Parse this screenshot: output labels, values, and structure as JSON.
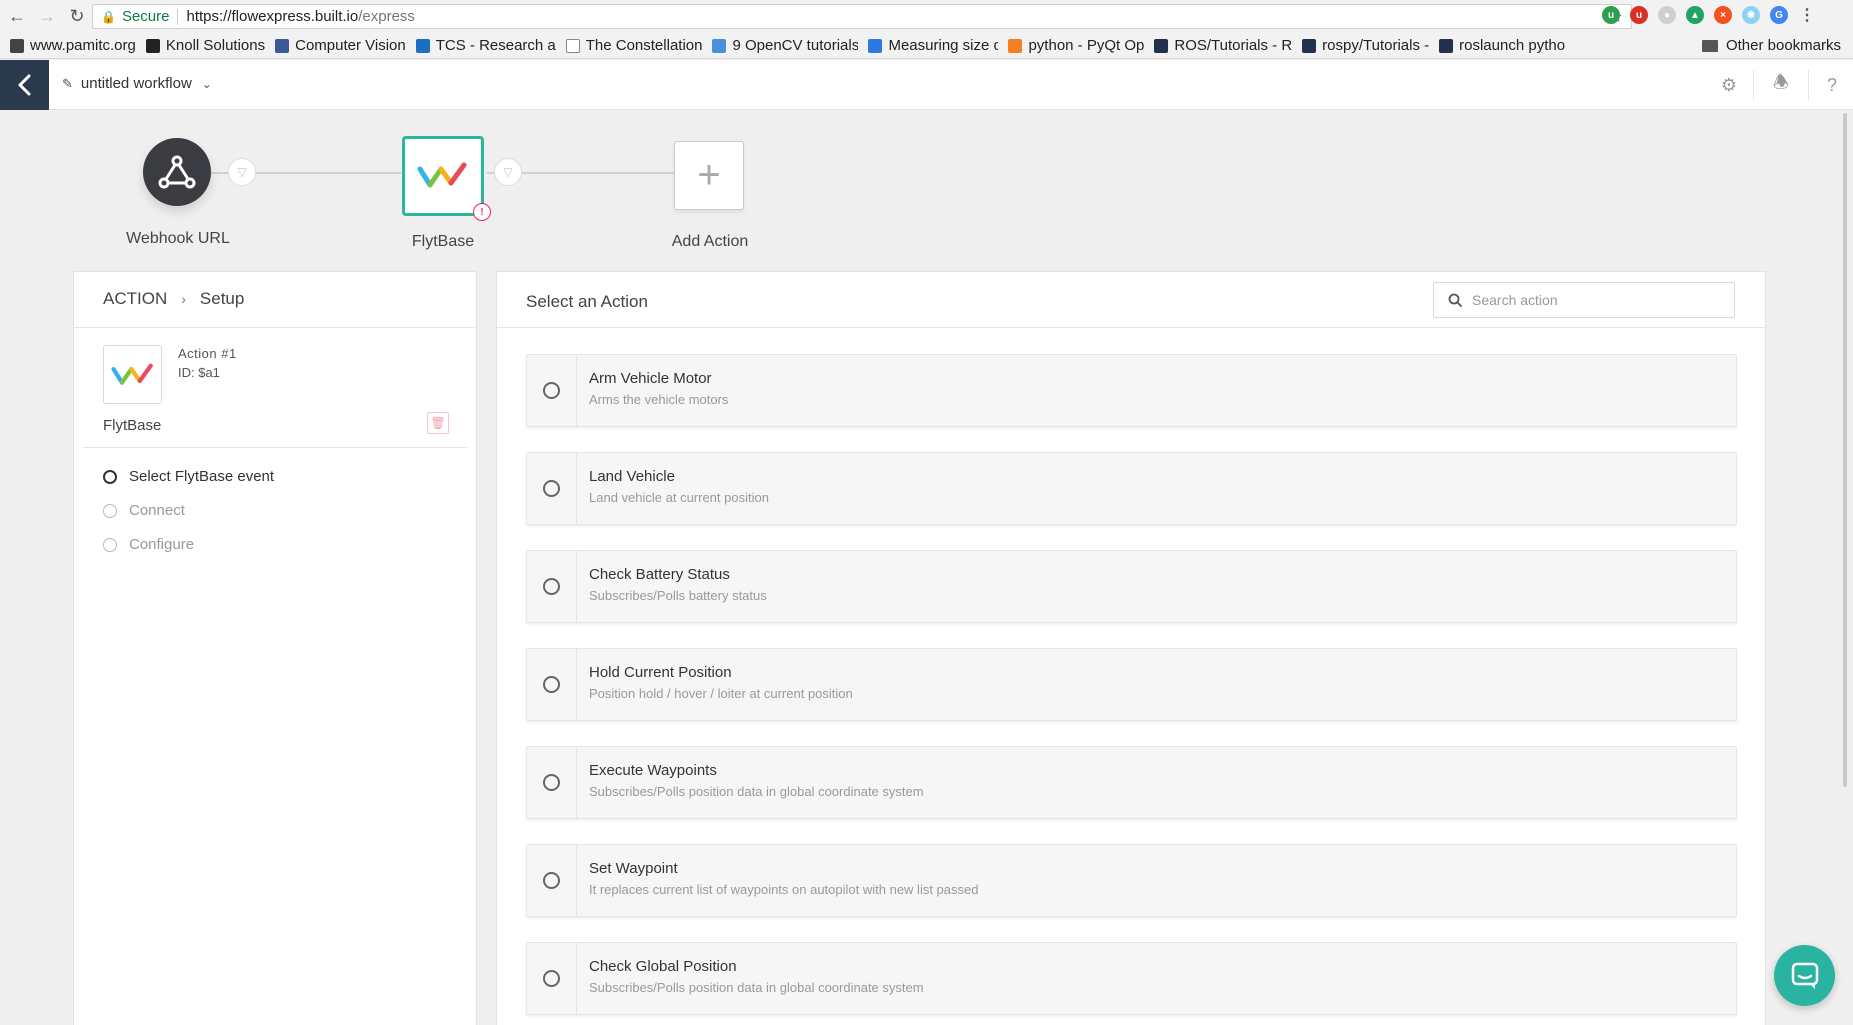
{
  "browser": {
    "secure_label": "Secure",
    "url_host": "https://flowexpress.built.io",
    "url_path": "/express",
    "bookmarks": [
      {
        "label": "www.pamitc.org",
        "icon": "keyboard-icon",
        "color": "#444444"
      },
      {
        "label": "Knoll Solutions",
        "icon": "knoll-icon",
        "color": "#222222"
      },
      {
        "label": "Computer Vision",
        "icon": "cv-icon",
        "color": "#3b5998"
      },
      {
        "label": "TCS - Research and",
        "icon": "tcs-icon",
        "color": "#1b6ec2"
      },
      {
        "label": "The Constellation",
        "icon": "page-icon",
        "color": "#ffffff"
      },
      {
        "label": "9 OpenCV tutorials",
        "icon": "opencv-icon",
        "color": "#4a90d9"
      },
      {
        "label": "Measuring size of",
        "icon": "p-icon",
        "color": "#2a7ae2"
      },
      {
        "label": "python - PyQt Op",
        "icon": "stack-icon",
        "color": "#f48024"
      },
      {
        "label": "ROS/Tutorials - R",
        "icon": "ros-icon",
        "color": "#22314e"
      },
      {
        "label": "rospy/Tutorials -",
        "icon": "ros-icon",
        "color": "#22314e"
      },
      {
        "label": "roslaunch pytho",
        "icon": "ros-icon",
        "color": "#22314e"
      }
    ],
    "other_bookmarks": "Other bookmarks"
  },
  "header": {
    "workflow_name": "untitled workflow"
  },
  "workflow": {
    "nodes": [
      {
        "label": "Webhook URL"
      },
      {
        "label": "FlytBase"
      },
      {
        "label": "Add Action"
      }
    ]
  },
  "left_panel": {
    "breadcrumb_root": "ACTION",
    "breadcrumb_current": "Setup",
    "action_number": "Action #1",
    "action_id": "ID: $a1",
    "app_name": "FlytBase",
    "steps": [
      {
        "label": "Select FlytBase event",
        "active": true
      },
      {
        "label": "Connect",
        "active": false
      },
      {
        "label": "Configure",
        "active": false
      }
    ]
  },
  "right_panel": {
    "title": "Select an Action",
    "search_placeholder": "Search action",
    "actions": [
      {
        "title": "Arm Vehicle Motor",
        "desc": "Arms the vehicle motors"
      },
      {
        "title": "Land Vehicle",
        "desc": "Land vehicle at current position"
      },
      {
        "title": "Check Battery Status",
        "desc": "Subscribes/Polls battery status"
      },
      {
        "title": "Hold Current Position",
        "desc": "Position hold / hover / loiter at current position"
      },
      {
        "title": "Execute Waypoints",
        "desc": "Subscribes/Polls position data in global coordinate system"
      },
      {
        "title": "Set Waypoint",
        "desc": "It replaces current list of waypoints on autopilot with new list passed"
      },
      {
        "title": "Check Global Position",
        "desc": "Subscribes/Polls position data in global coordinate system"
      }
    ]
  },
  "colors": {
    "accent": "#29b89a",
    "header_back": "#2a3a4c",
    "chat": "#2ab3a0"
  }
}
